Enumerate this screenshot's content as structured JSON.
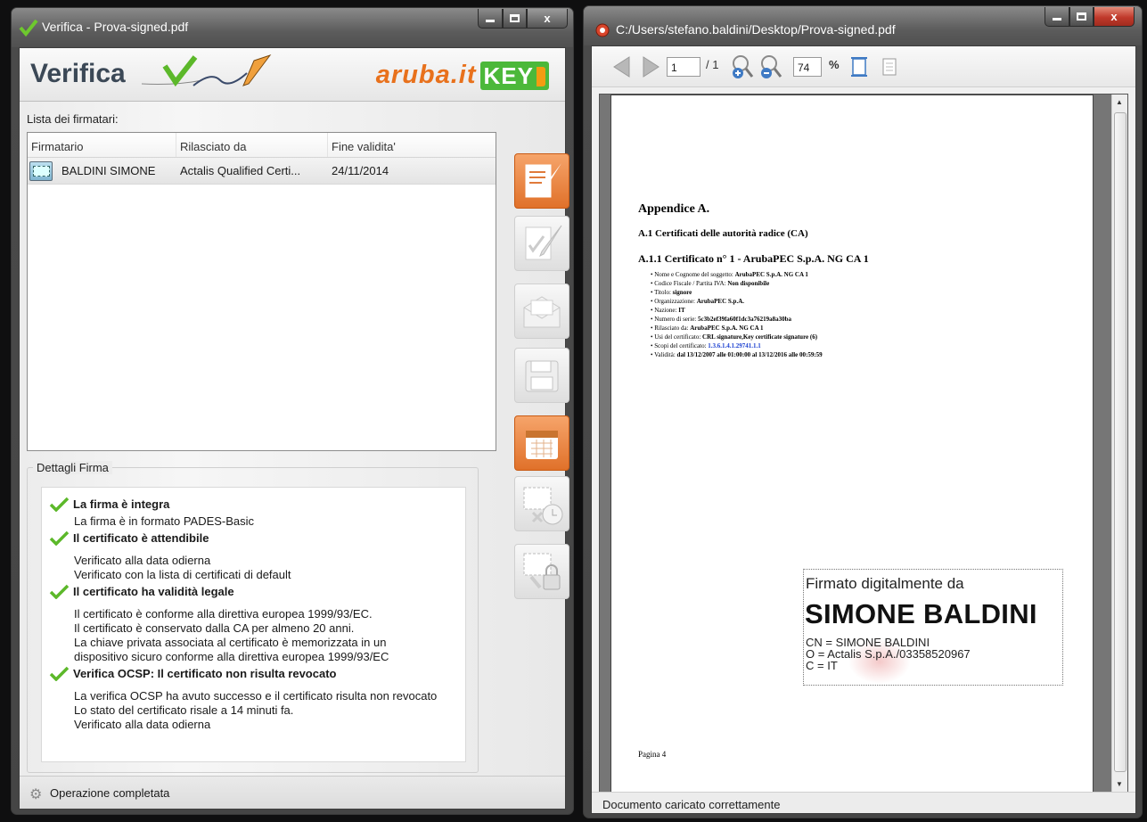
{
  "left_window": {
    "title": "Verifica - Prova-signed.pdf",
    "banner_title": "Verifica",
    "logo_text": "aruba.it",
    "logo_key": "KEY",
    "signers_label": "Lista dei firmatari:",
    "columns": [
      "Firmatario",
      "Rilasciato da",
      "Fine validita'"
    ],
    "signers": [
      {
        "name": "BALDINI SIMONE",
        "issuer": "Actalis Qualified Certi...",
        "end": "24/11/2014"
      }
    ],
    "details_title": "Dettagli Firma",
    "details": [
      {
        "heading": "La firma è integra",
        "lines": [
          "La firma è in formato PADES-Basic"
        ]
      },
      {
        "heading": "Il certificato è attendibile",
        "lines": [
          "Verificato alla data odierna",
          "Verificato con la lista di certificati di default"
        ]
      },
      {
        "heading": "Il certificato ha validità legale",
        "lines": [
          "Il certificato è conforme alla direttiva europea 1999/93/EC.",
          "Il certificato è conservato dalla CA per almeno 20 anni.",
          "La chiave privata associata al certificato è memorizzata in un",
          "dispositivo sicuro conforme alla direttiva europea 1999/93/EC"
        ]
      },
      {
        "heading": "Verifica OCSP: Il certificato non risulta revocato",
        "lines": [
          "La verifica OCSP ha avuto successo e il certificato risulta non revocato",
          "Lo stato del certificato risale a 14 minuti fa.",
          "Verificato alla data odierna"
        ]
      }
    ],
    "status": "Operazione completata"
  },
  "right_window": {
    "title": "C:/Users/stefano.baldini/Desktop/Prova-signed.pdf",
    "page_input": "1",
    "page_total": "/ 1",
    "zoom_value": "74",
    "zoom_unit": "%",
    "doc": {
      "h1": "Appendice A.",
      "h2": "A.1 Certificati delle autorità radice (CA)",
      "h3": "A.1.1 Certificato n° 1 - ArubaPEC S.p.A. NG CA 1",
      "bullets": [
        {
          "label": "Nome e Cognome del soggetto: ",
          "value": "ArubaPEC S.p.A. NG CA 1"
        },
        {
          "label": "Codice Fiscale / Partita IVA: ",
          "value": "Non disponibile"
        },
        {
          "label": "Titolo: ",
          "value": "signore"
        },
        {
          "label": "Organizzazione: ",
          "value": "ArubaPEC S.p.A."
        },
        {
          "label": "Nazione: ",
          "value": "IT"
        },
        {
          "label": "Numero di serie: ",
          "value": "5c3b2ef39fa60f1dc3a76219a8a30ba"
        },
        {
          "label": "Rilasciato da: ",
          "value": "ArubaPEC S.p.A. NG CA 1"
        },
        {
          "label": "Usi del certificato: ",
          "value": "CRL signature,Key certificate signature (6)"
        },
        {
          "label": "Scopi del certificato: ",
          "value": "1.3.6.1.4.1.29741.1.1"
        },
        {
          "label": "Validità: ",
          "value": "dal 13/12/2007 alle 01:00:00 al 13/12/2016 alle 00:59:59"
        }
      ],
      "sig_line1": "Firmato digitalmente da",
      "sig_name": "SIMONE BALDINI",
      "sig_cn": "CN = SIMONE BALDINI",
      "sig_o": "O = Actalis S.p.A./03358520967",
      "sig_c": "C = IT",
      "footer": "Pagina 4"
    },
    "status": "Documento caricato correttamente"
  }
}
